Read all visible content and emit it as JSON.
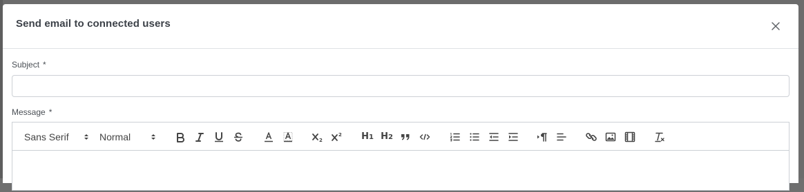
{
  "dialog": {
    "title": "Send email to connected users",
    "close_icon": "close-icon"
  },
  "form": {
    "subject_label": "Subject",
    "subject_required": "*",
    "subject_value": "",
    "message_label": "Message",
    "message_required": "*"
  },
  "toolbar": {
    "font_family": "Sans Serif",
    "font_size": "Normal",
    "buttons": [
      "bold",
      "italic",
      "underline",
      "strike",
      "text-color",
      "background-color",
      "subscript",
      "superscript",
      "heading-1",
      "heading-2",
      "blockquote",
      "code-block",
      "ordered-list",
      "bullet-list",
      "outdent",
      "indent",
      "text-direction",
      "align",
      "link",
      "image",
      "video",
      "clear-formatting"
    ],
    "h1_text": "H",
    "h1_sub": "1",
    "h2_text": "H",
    "h2_sub": "2"
  },
  "colors": {
    "title": "#3c4148",
    "border": "#ccd0d5",
    "icon": "#444444",
    "backdrop": "#6c6c6c"
  }
}
